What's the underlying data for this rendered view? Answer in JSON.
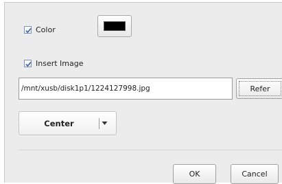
{
  "color_option": {
    "checked": true,
    "label": "Color",
    "swatch_color": "#000000"
  },
  "image_option": {
    "checked": true,
    "label": "Insert Image",
    "path_value": "/mnt/xusb/disk1p1/1224127998.jpg",
    "refer_label": "Refer"
  },
  "alignment": {
    "selected": "Center"
  },
  "dialog_buttons": {
    "ok_label": "OK",
    "cancel_label": "Cancel"
  },
  "colors": {
    "panel_bg": "#ececec",
    "checkbox_border": "#7b93b8",
    "checkmark": "#3a5f9a"
  }
}
